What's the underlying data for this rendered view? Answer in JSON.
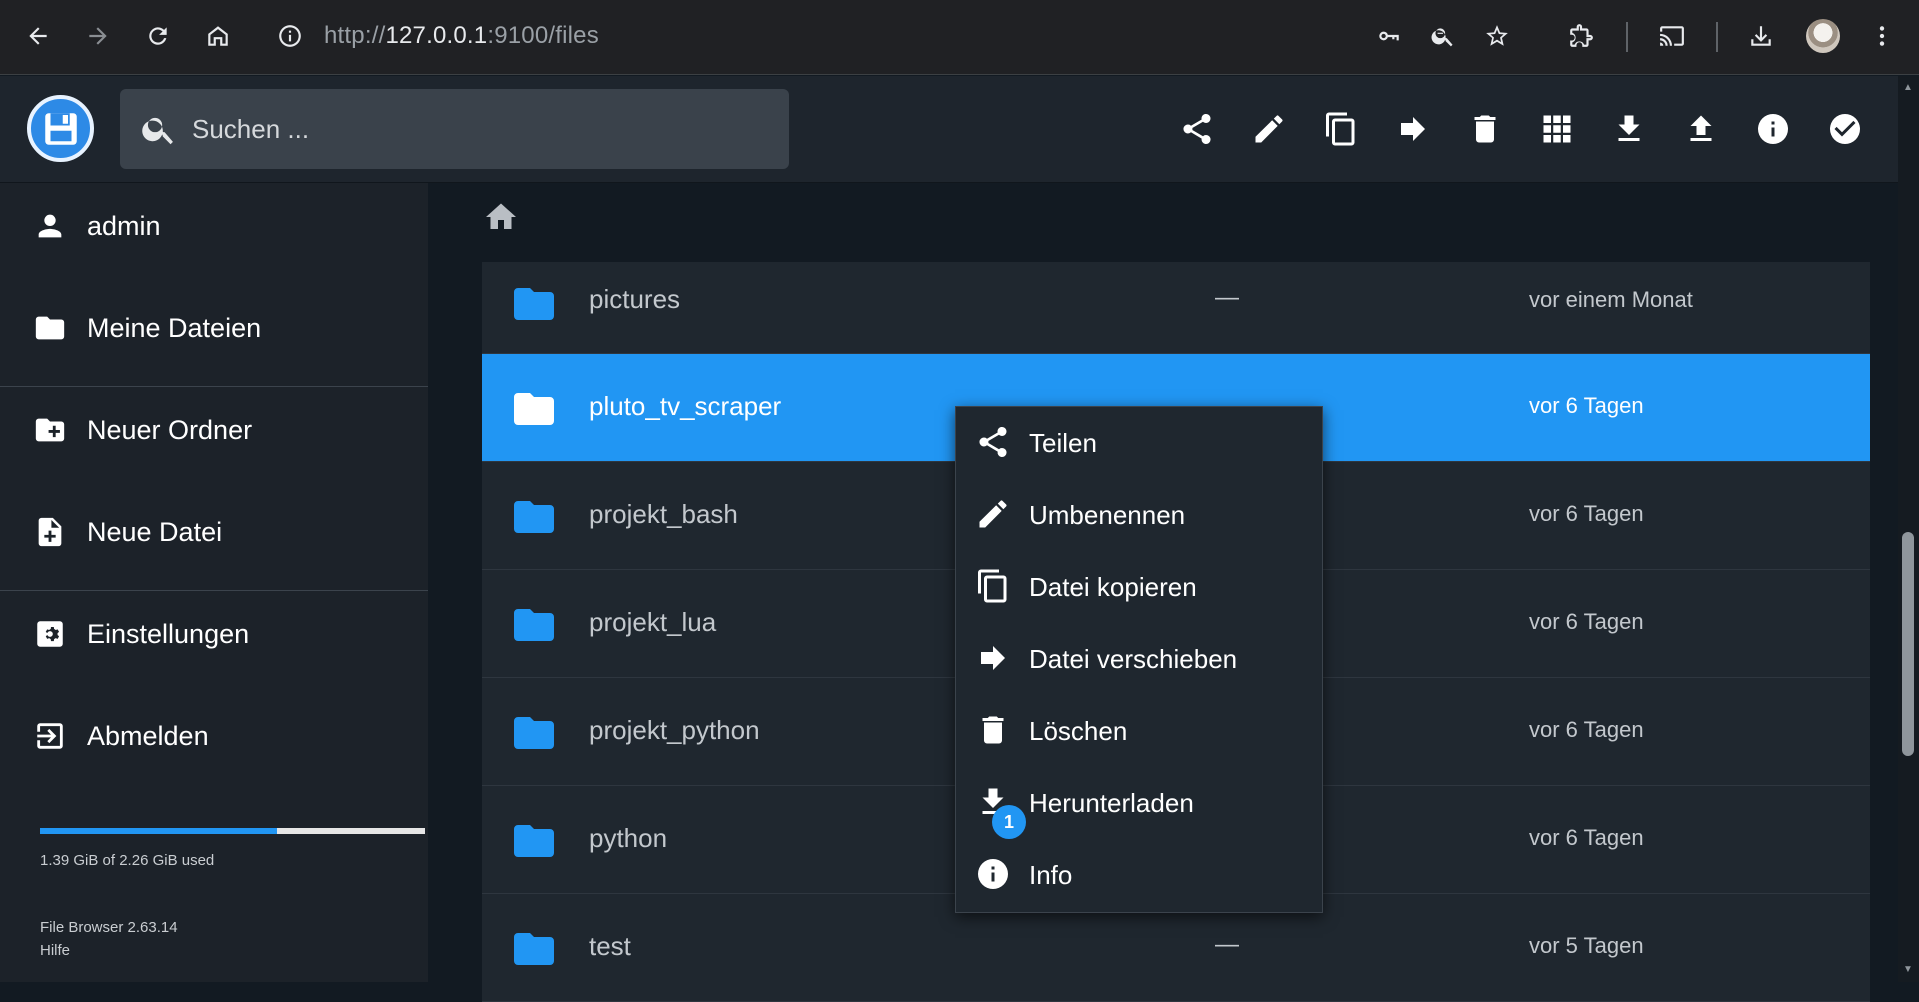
{
  "browser": {
    "url_prefix": "http://",
    "url_host": "127.0.0.1",
    "url_rest": ":9100/files"
  },
  "search": {
    "placeholder": "Suchen ..."
  },
  "toolbar": {
    "download_badge": "1"
  },
  "sidebar": {
    "items": [
      {
        "label": "admin",
        "icon": "person-icon"
      },
      {
        "label": "Meine Dateien",
        "icon": "folder-icon"
      },
      {
        "label": "Neuer Ordner",
        "icon": "create-new-folder-icon"
      },
      {
        "label": "Neue Datei",
        "icon": "note-add-icon"
      },
      {
        "label": "Einstellungen",
        "icon": "settings-icon"
      },
      {
        "label": "Abmelden",
        "icon": "exit-icon"
      }
    ],
    "quota_used_fraction": 0.615,
    "quota_text": "1.39 GiB of 2.26 GiB used",
    "version": "File Browser 2.63.14",
    "help": "Hilfe"
  },
  "files": [
    {
      "name": "pictures",
      "size": "—",
      "modified": "vor einem Monat"
    },
    {
      "name": "pluto_tv_scraper",
      "size": "",
      "modified": "vor 6 Tagen",
      "selected": true
    },
    {
      "name": "projekt_bash",
      "size": "",
      "modified": "vor 6 Tagen"
    },
    {
      "name": "projekt_lua",
      "size": "",
      "modified": "vor 6 Tagen"
    },
    {
      "name": "projekt_python",
      "size": "",
      "modified": "vor 6 Tagen"
    },
    {
      "name": "python",
      "size": "",
      "modified": "vor 6 Tagen"
    },
    {
      "name": "test",
      "size": "—",
      "modified": "vor 5 Tagen"
    }
  ],
  "context_menu": {
    "items": [
      {
        "label": "Teilen",
        "icon": "share-icon"
      },
      {
        "label": "Umbenennen",
        "icon": "edit-icon"
      },
      {
        "label": "Datei kopieren",
        "icon": "copy-icon"
      },
      {
        "label": "Datei verschieben",
        "icon": "forward-icon"
      },
      {
        "label": "Löschen",
        "icon": "delete-icon"
      },
      {
        "label": "Herunterladen",
        "icon": "download-icon"
      },
      {
        "label": "Info",
        "icon": "info-icon"
      }
    ],
    "download_badge": "1"
  },
  "colors": {
    "accent": "#2196f3",
    "background": "#121a22",
    "sidebar": "#1c2229"
  }
}
